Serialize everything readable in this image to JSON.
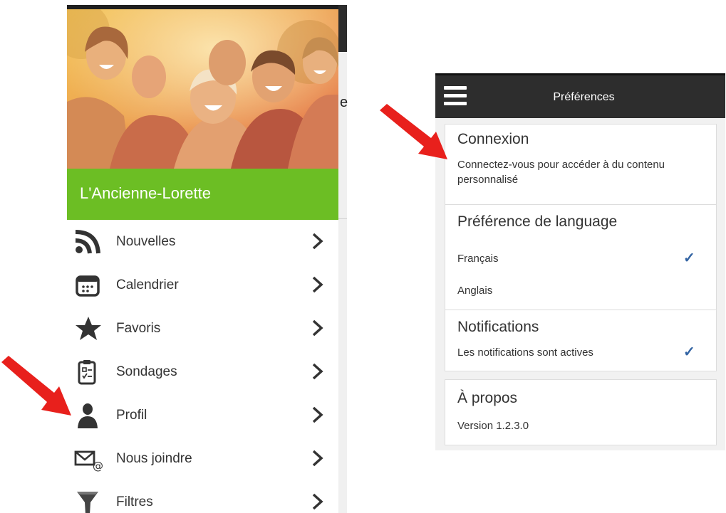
{
  "left_screen": {
    "city_name": "L'Ancienne-Lorette",
    "menu": [
      {
        "label": "Nouvelles",
        "icon": "rss-icon"
      },
      {
        "label": "Calendrier",
        "icon": "calendar-icon"
      },
      {
        "label": "Favoris",
        "icon": "star-icon"
      },
      {
        "label": "Sondages",
        "icon": "clipboard-icon"
      },
      {
        "label": "Profil",
        "icon": "person-icon"
      },
      {
        "label": "Nous joindre",
        "icon": "mail-at-icon"
      },
      {
        "label": "Filtres",
        "icon": "funnel-icon"
      }
    ],
    "behind_letter": "e",
    "accent_color": "#6cbe24"
  },
  "right_screen": {
    "title": "Préférences",
    "connexion": {
      "title": "Connexion",
      "text": "Connectez-vous pour accéder à du contenu personnalisé"
    },
    "language": {
      "title": "Préférence de language",
      "options": [
        {
          "label": "Français",
          "selected": true
        },
        {
          "label": "Anglais",
          "selected": false
        }
      ]
    },
    "notifications": {
      "title": "Notifications",
      "status": "Les notifications sont actives",
      "enabled": true
    },
    "about": {
      "title": "À propos",
      "version": "Version 1.2.3.0"
    },
    "check_color": "#3465a4"
  },
  "annotation_color": "#e8201c"
}
